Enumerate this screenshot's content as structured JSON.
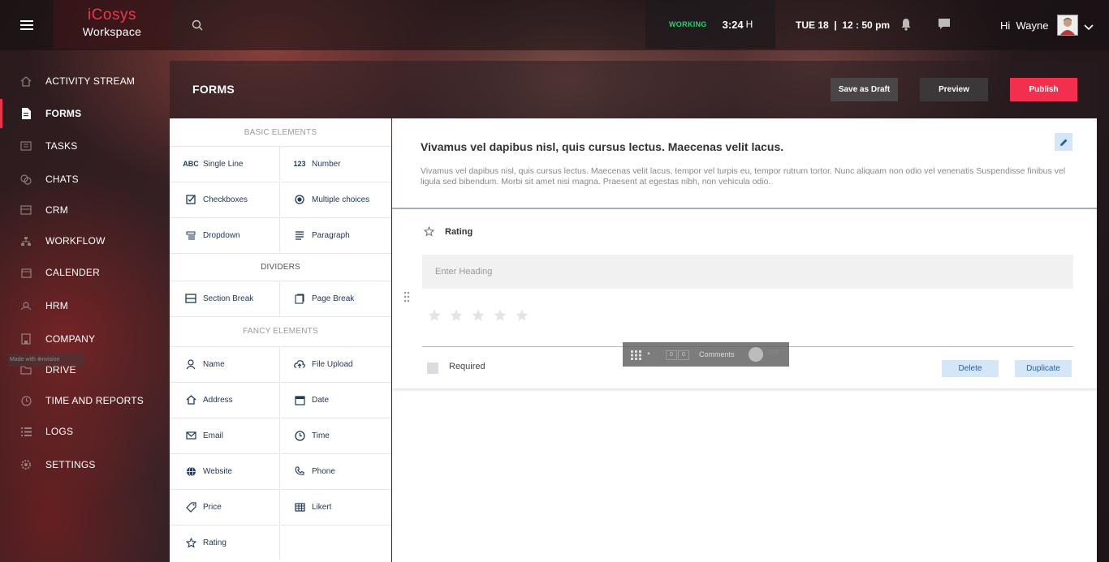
{
  "app": {
    "brand_name": "iCosys",
    "brand_sub": "Workspace"
  },
  "topbar": {
    "working_label": "WORKING",
    "working_time": "3:24",
    "working_unit": "H",
    "date_time": "TUE 18  |  12 : 50 pm",
    "greeting": "Hi  Wayne",
    "icons": [
      "menu-icon",
      "search-icon",
      "bell-icon",
      "chat-icon",
      "avatar",
      "chevron-down-icon"
    ]
  },
  "sidebar": {
    "items": [
      {
        "label": "ACTIVITY STREAM",
        "icon": "home-icon"
      },
      {
        "label": "FORMS",
        "icon": "document-icon"
      },
      {
        "label": "TASKS",
        "icon": "tasks-icon"
      },
      {
        "label": "CHATS",
        "icon": "chats-icon"
      },
      {
        "label": "CRM",
        "icon": "crm-icon"
      },
      {
        "label": "WORKFLOW",
        "icon": "workflow-icon"
      },
      {
        "label": "CALENDER",
        "icon": "calendar-icon"
      },
      {
        "label": "HRM",
        "icon": "hrm-icon"
      },
      {
        "label": "COMPANY",
        "icon": "company-icon"
      },
      {
        "label": "DRIVE",
        "icon": "folder-icon"
      },
      {
        "label": "TIME AND REPORTS",
        "icon": "clock-icon"
      },
      {
        "label": "LOGS",
        "icon": "list-icon"
      },
      {
        "label": "SETTINGS",
        "icon": "gear-icon"
      }
    ],
    "active": "FORMS"
  },
  "header": {
    "title": "FORMS",
    "save_draft": "Save as Draft",
    "preview": "Preview",
    "publish": "Publish"
  },
  "elements_panel": {
    "basic_heading": "BASIC ELEMENTS",
    "dividers_heading": "DIVIDERS",
    "fancy_heading": "FANCY ELEMENTS",
    "basic": [
      {
        "label": "Single Line",
        "icon": "ABC"
      },
      {
        "label": "Number",
        "icon": "123"
      },
      {
        "label": "Checkboxes",
        "icon": "checkbox-icon"
      },
      {
        "label": "Multiple choices",
        "icon": "radio-icon"
      },
      {
        "label": "Dropdown",
        "icon": "dropdown-icon"
      },
      {
        "label": "Paragraph",
        "icon": "paragraph-icon"
      }
    ],
    "dividers": [
      {
        "label": "Section Break",
        "icon": "section-break-icon"
      },
      {
        "label": "Page Break",
        "icon": "page-break-icon"
      }
    ],
    "fancy": [
      {
        "label": "Name",
        "icon": "person-icon"
      },
      {
        "label": "File Upload",
        "icon": "cloud-upload-icon"
      },
      {
        "label": "Address",
        "icon": "home-icon"
      },
      {
        "label": "Date",
        "icon": "calendar-icon"
      },
      {
        "label": "Email",
        "icon": "mail-icon"
      },
      {
        "label": "Time",
        "icon": "clock-icon"
      },
      {
        "label": "Website",
        "icon": "globe-icon"
      },
      {
        "label": "Phone",
        "icon": "phone-icon"
      },
      {
        "label": "Price",
        "icon": "tag-icon"
      },
      {
        "label": "Likert",
        "icon": "table-icon"
      },
      {
        "label": "Rating",
        "icon": "star-icon"
      }
    ]
  },
  "form": {
    "title": "Vivamus vel dapibus nisl, quis cursus lectus. Maecenas velit lacus.",
    "description": "Vivamus vel dapibus nisl, quis cursus lectus. Maecenas velit lacus, tempor vel turpis eu, tempor rutrum tortor. Nunc aliquam non odio vel venenatis Suspendisse finibus vel ligula sed bibendum. Morbi sit amet nisi magna. Praesent at egestas nibh, non vehicula odio.",
    "field": {
      "type": "Rating",
      "heading_placeholder": "Enter Heading",
      "heading_value": "",
      "stars_total": 5,
      "stars_selected": 0,
      "required_label": "Required",
      "required_checked": false,
      "delete_label": "Delete",
      "duplicate_label": "Duplicate"
    }
  },
  "comment_bar": {
    "count_a": "0",
    "count_b": "0",
    "label": "Comments",
    "toggle": "OFF"
  },
  "watermark": "Made with ⊕nvision",
  "colors": {
    "accent": "#f22f4c",
    "brand": "#e83a4a",
    "working": "#22d66a",
    "button_light": "#d4e6f8"
  }
}
